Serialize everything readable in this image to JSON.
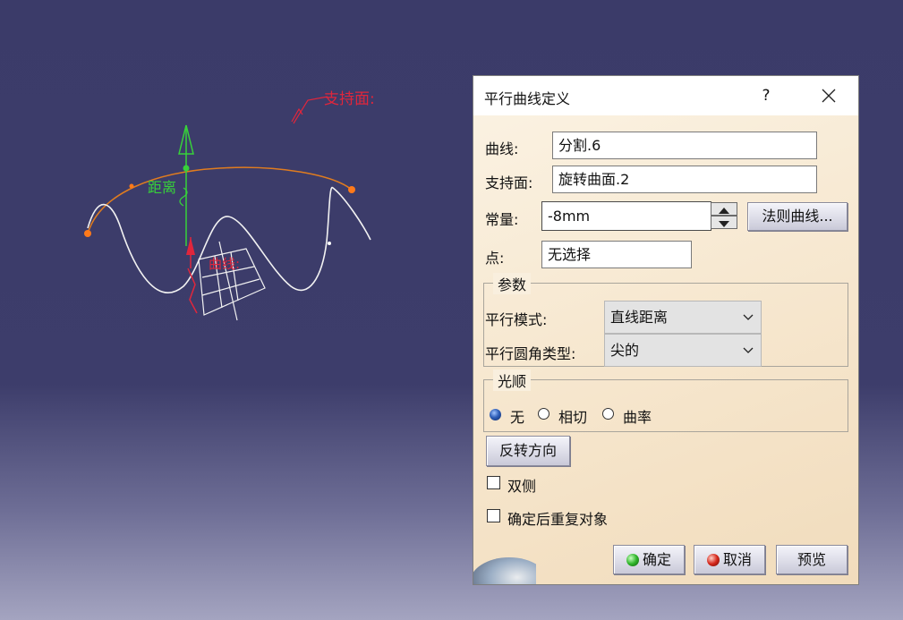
{
  "scene": {
    "label_support": "支持面:",
    "label_distance": "距离",
    "label_curve": "曲线:",
    "colors": {
      "curve": "#f2f2f2",
      "arc": "#e07c1f",
      "label_red": "#e0263c",
      "label_green": "#37d13a",
      "background_top": "#3b3b69",
      "background_bottom": "#a4a4c0"
    }
  },
  "dialog": {
    "title": "平行曲线定义",
    "help_glyph": "?",
    "curve_label": "曲线:",
    "curve_value": "分割.6",
    "support_label": "支持面:",
    "support_value": "旋转曲面.2",
    "constant_label": "常量:",
    "constant_value": "-8mm",
    "law_button": "法则曲线...",
    "point_label": "点:",
    "point_value": "无选择",
    "params_group": "参数",
    "parallel_mode_label": "平行模式:",
    "parallel_mode_value": "直线距离",
    "corner_type_label": "平行圆角类型:",
    "corner_type_value": "尖的",
    "smoothing_group": "光顺",
    "smoothing_options": [
      "无",
      "相切",
      "曲率"
    ],
    "smoothing_selected": "无",
    "reverse_button": "反转方向",
    "both_sides_label": "双侧",
    "repeat_label": "确定后重复对象",
    "ok_button": "确定",
    "cancel_button": "取消",
    "preview_button": "预览",
    "icons": {
      "close": "close-icon",
      "ok": "green-ball-icon",
      "cancel": "red-ball-icon"
    }
  }
}
